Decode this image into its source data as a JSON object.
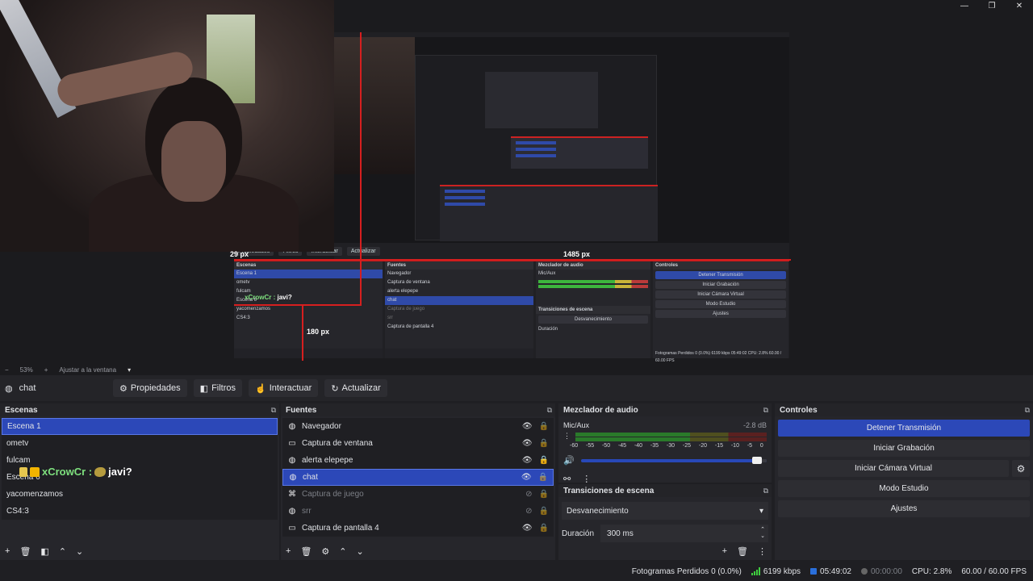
{
  "window": {
    "minimize": "—",
    "maximize": "❐",
    "close": "✕"
  },
  "preview": {
    "measure_top": "1485 px",
    "measure_left": "29 px",
    "measure_bottom": "180 px",
    "nested_labels": {
      "toolbar": [
        "Propiedades",
        "Filtros",
        "Interactuar",
        "Actualizar"
      ],
      "scenes": [
        "Escena 1",
        "ometv",
        "fulcam",
        "Escena 6",
        "yacomenzamos",
        "CS4:3"
      ],
      "sources": [
        "Navegador",
        "Captura de ventana",
        "alerta elepepe",
        "chat",
        "Captura de juego",
        "srr",
        "Captura de pantalla 4"
      ],
      "controls": [
        "Detener Transmisión",
        "Iniciar Grabación",
        "Iniciar Cámara Virtual",
        "Modo Estudio",
        "Ajustes"
      ],
      "status": "Fotogramas Perdidos 0 (0.0%)   6199 kbps   05:49:02   CPU: 2.8%   60.00 / 60.00 FPS"
    }
  },
  "zoom": {
    "minus": "−",
    "value": "53%",
    "plus": "+",
    "fit": "Ajustar a la ventana",
    "dropdown": "▾"
  },
  "source_toolbar": {
    "selected_source": "chat",
    "buttons": [
      {
        "label": "Propiedades",
        "icon": "gear-icon"
      },
      {
        "label": "Filtros",
        "icon": "filter-icon"
      },
      {
        "label": "Interactuar",
        "icon": "pointer-icon"
      },
      {
        "label": "Actualizar",
        "icon": "refresh-icon"
      }
    ]
  },
  "scenes": {
    "title": "Escenas",
    "items": [
      "Escena 1",
      "ometv",
      "fulcam",
      "Escena 6",
      "yacomenzamos",
      "CS4:3"
    ],
    "selected": 0
  },
  "chat_overlay": {
    "user": "xCrowCr :",
    "message": "javi?"
  },
  "sources": {
    "title": "Fuentes",
    "items": [
      {
        "label": "Navegador",
        "icon": "globe-icon",
        "visible": true,
        "locked": false,
        "dim": false
      },
      {
        "label": "Captura de ventana",
        "icon": "window-icon",
        "visible": true,
        "locked": false,
        "dim": false
      },
      {
        "label": "alerta elepepe",
        "icon": "globe-icon",
        "visible": true,
        "locked": true,
        "dim": false
      },
      {
        "label": "chat",
        "icon": "globe-icon",
        "visible": true,
        "locked": false,
        "dim": false
      },
      {
        "label": "Captura de juego",
        "icon": "gamepad-icon",
        "visible": false,
        "locked": false,
        "dim": true
      },
      {
        "label": "srr",
        "icon": "globe-icon",
        "visible": false,
        "locked": false,
        "dim": true
      },
      {
        "label": "Captura de pantalla 4",
        "icon": "monitor-icon",
        "visible": true,
        "locked": false,
        "dim": false
      }
    ],
    "selected": 3
  },
  "mixer": {
    "title": "Mezclador de audio",
    "channel": "Mic/Aux",
    "db": "-2.8 dB",
    "ticks": [
      "-60",
      "-55",
      "-50",
      "-45",
      "-40",
      "-35",
      "-30",
      "-25",
      "-20",
      "-15",
      "-10",
      "-5",
      "0"
    ],
    "volume_percent": 95
  },
  "transitions": {
    "title": "Transiciones de escena",
    "selected": "Desvanecimiento",
    "duration_label": "Duración",
    "duration_value": "300 ms"
  },
  "controls": {
    "title": "Controles",
    "stream": "Detener Transmisión",
    "record": "Iniciar Grabación",
    "virtualcam": "Iniciar Cámara Virtual",
    "studio": "Modo Estudio",
    "settings": "Ajustes"
  },
  "status": {
    "dropped": "Fotogramas Perdidos 0 (0.0%)",
    "bitrate": "6199 kbps",
    "live_time": "05:49:02",
    "rec_time": "00:00:00",
    "cpu": "CPU: 2.8%",
    "fps": "60.00 / 60.00 FPS"
  },
  "colors": {
    "accent": "#2c48b8",
    "measure": "#d61f1f",
    "chat_user": "#7ee07e"
  }
}
